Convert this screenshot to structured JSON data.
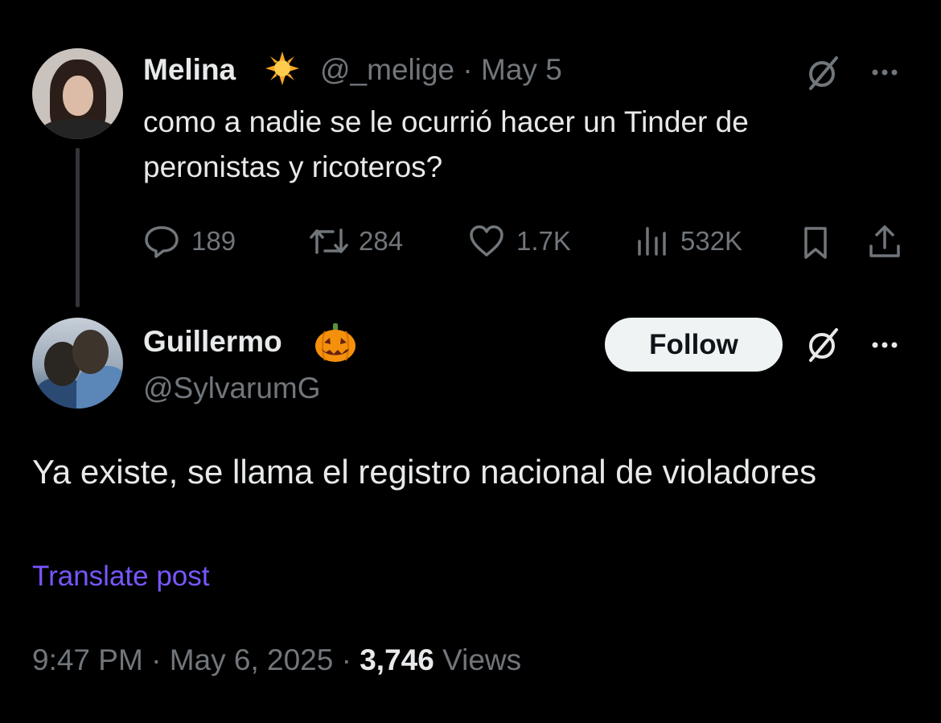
{
  "parent_tweet": {
    "name": "Melina",
    "badge_icon": "sun-emoji",
    "handle": "@_melige",
    "separator": "·",
    "date": "May 5",
    "text": "como a nadie se le ocurrió hacer un Tinder de peronistas y ricoteros?",
    "actions": {
      "replies": "189",
      "reposts": "284",
      "likes": "1.7K",
      "views": "532K"
    }
  },
  "reply_tweet": {
    "name": "Guillermo",
    "badge_icon": "jack-o-lantern-emoji",
    "handle": "@SylvarumG",
    "follow_label": "Follow",
    "text": "Ya existe, se llama el registro nacional de violadores",
    "translate_label": "Translate post",
    "time": "9:47 PM",
    "date": "May 6, 2025",
    "separator": "·",
    "views_count": "3,746",
    "views_label": "Views"
  },
  "colors": {
    "background": "#000000",
    "primary_text": "#e7e9ea",
    "secondary_text": "#71767b",
    "link": "#7856ff",
    "follow_bg": "#eff3f4",
    "thread_line": "#333639"
  }
}
